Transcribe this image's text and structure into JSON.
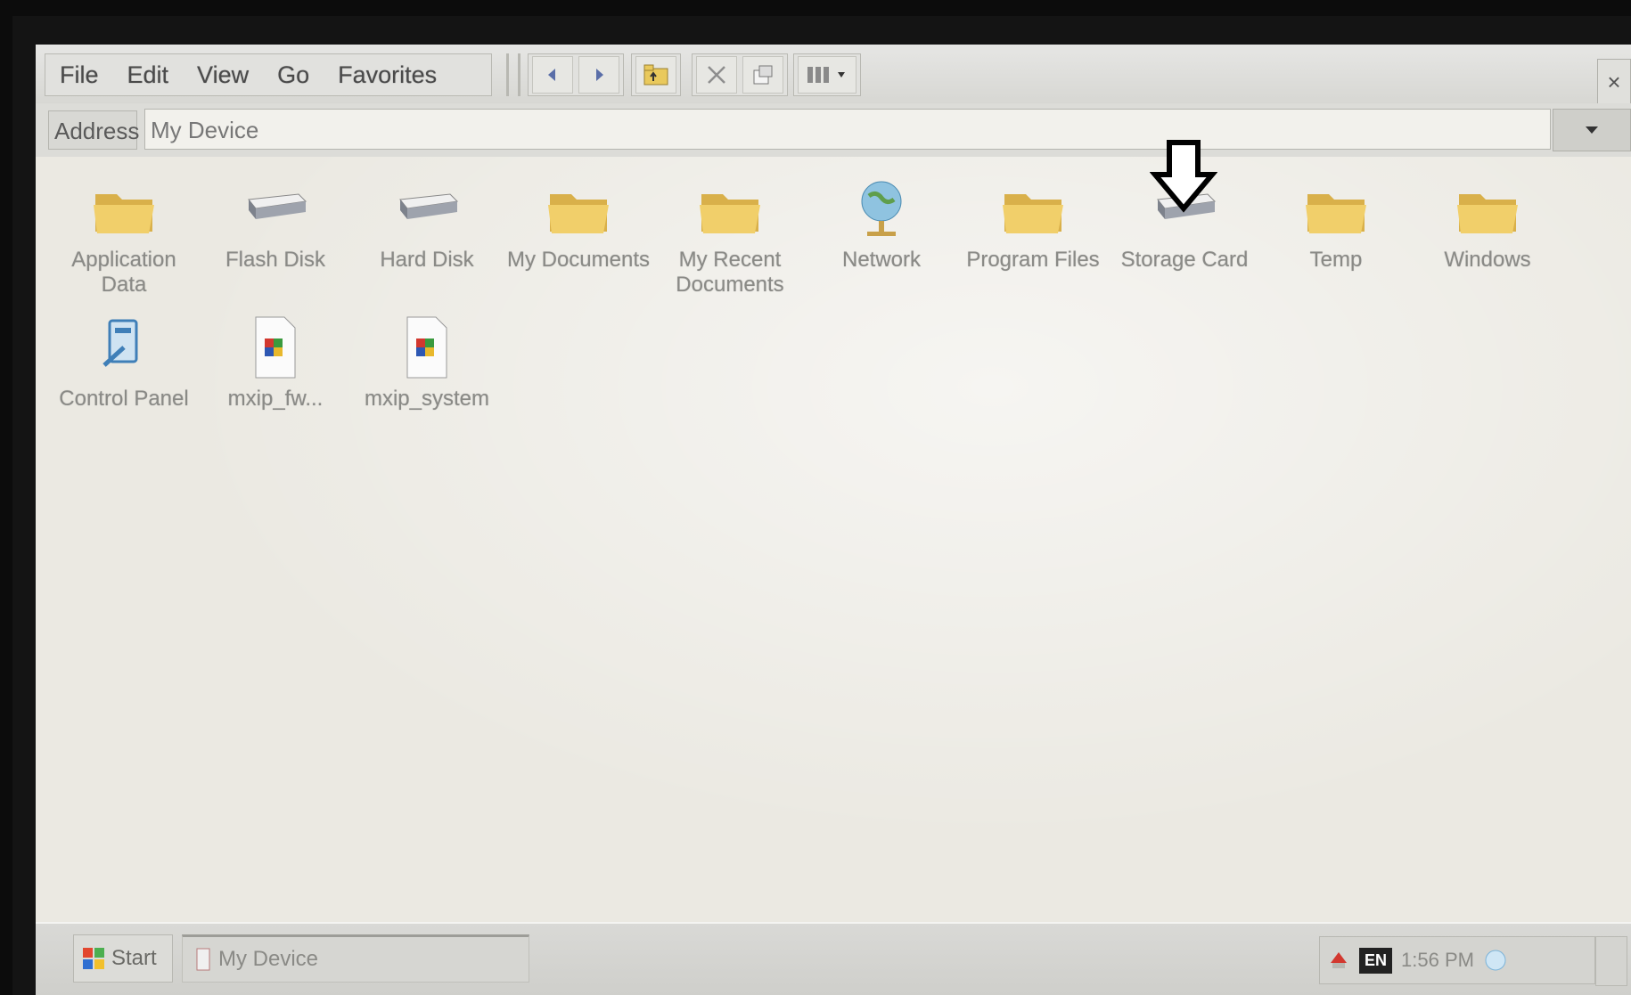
{
  "menu": {
    "file": "File",
    "edit": "Edit",
    "view": "View",
    "go": "Go",
    "favorites": "Favorites"
  },
  "toolbar": {
    "icons": [
      "back-icon",
      "forward-icon",
      "up-folder-icon",
      "delete-icon",
      "properties-icon",
      "views-icon"
    ]
  },
  "address": {
    "label": "Address",
    "value": "My Device"
  },
  "items": [
    {
      "label": "Application Data",
      "icon": "folder-icon"
    },
    {
      "label": "Flash Disk",
      "icon": "drive-icon"
    },
    {
      "label": "Hard Disk",
      "icon": "drive-icon"
    },
    {
      "label": "My Documents",
      "icon": "folder-icon"
    },
    {
      "label": "My Recent Documents",
      "icon": "folder-icon"
    },
    {
      "label": "Network",
      "icon": "network-globe-icon"
    },
    {
      "label": "Program Files",
      "icon": "folder-icon"
    },
    {
      "label": "Storage Card",
      "icon": "drive-icon"
    },
    {
      "label": "Temp",
      "icon": "folder-icon"
    },
    {
      "label": "Windows",
      "icon": "folder-icon"
    },
    {
      "label": "Control Panel",
      "icon": "control-panel-icon"
    },
    {
      "label": "mxip_fw...",
      "icon": "file-icon"
    },
    {
      "label": "mxip_system",
      "icon": "file-icon"
    }
  ],
  "taskbar": {
    "start_label": "Start",
    "task_label": "My Device",
    "clock": "1:56 PM",
    "keyboard_badge": "EN"
  },
  "colors": {
    "folder": "#f1cf6a",
    "window_bg": "#ebe9e2",
    "label_text": "#8a8a86"
  }
}
